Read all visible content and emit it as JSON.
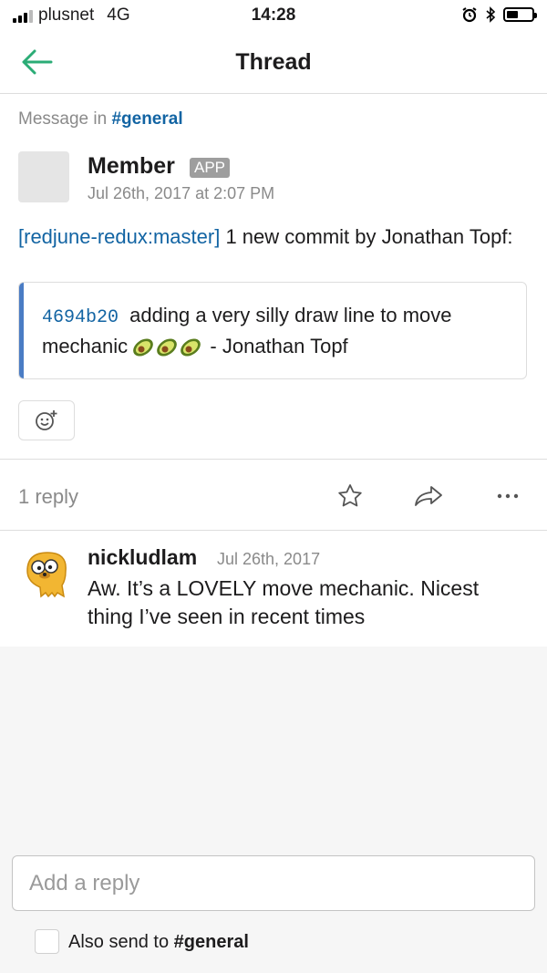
{
  "status_bar": {
    "carrier": "plusnet",
    "network": "4G",
    "time": "14:28"
  },
  "nav": {
    "title": "Thread"
  },
  "context": {
    "prefix": "Message in",
    "channel": "#general"
  },
  "message": {
    "author": "Member",
    "badge": "APP",
    "timestamp": "Jul 26th, 2017 at 2:07 PM",
    "link_text": "[redjune-redux:master]",
    "text": " 1 new commit by Jonathan Topf:",
    "attachment": {
      "commit_hash": "4694b20",
      "commit_text": "adding a very silly draw line to move mechanic",
      "commit_author": " - Jonathan Topf",
      "accent_color": "#4a7cc4"
    }
  },
  "thread": {
    "reply_count": "1 reply"
  },
  "reply": {
    "author": "nickludlam",
    "timestamp": "Jul 26th, 2017",
    "text": "Aw. It’s a LOVELY move mechanic. Nicest thing I’ve seen in recent times"
  },
  "composer": {
    "placeholder": "Add a reply",
    "also_send_label": "Also send to",
    "also_send_channel": "#general"
  },
  "icons": [
    "back-arrow-icon",
    "add-reaction-icon",
    "star-icon",
    "share-icon",
    "more-icon",
    "avocado-icon"
  ],
  "colors": {
    "link": "#1264a3",
    "back_arrow": "#2bac76",
    "muted": "#8a8a8a"
  }
}
